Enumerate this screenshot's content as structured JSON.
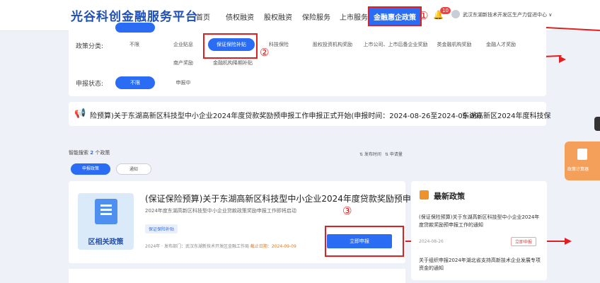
{
  "header": {
    "logo": "光谷科创金融服务平台",
    "nav": [
      "首页",
      "债权融资",
      "股权融资",
      "保险服务",
      "上市服务",
      "金融惠企政策"
    ],
    "notification_count": "10",
    "user": "武汉东湖新技术开发区生产力促进中心 ∨"
  },
  "annotations": {
    "one": "①",
    "two": "②",
    "three": "③"
  },
  "filters": {
    "policy_label": "政策分类:",
    "policy_options": [
      "不限",
      "企业贴息",
      "保证保险补贴",
      "科技保险",
      "股权投资机构奖励",
      "上市公司、上市后备企业奖励",
      "类金融机构奖励",
      "金融人才奖励",
      "南产奖励",
      "金融机构降期补贴"
    ],
    "status_label": "申报状态:",
    "status_options": [
      "不限",
      "申报中"
    ]
  },
  "notice": {
    "text": "险预算)关于东湖高新区科技型中小企业2024年度贷款奖励预申报工作申报正式开始(申报时间：2024-08-26至2024-09-09)",
    "text2": "东湖高新区2024年度科技保"
  },
  "results": {
    "prefix": "智能搜索",
    "count": "2",
    "suffix": "个政策",
    "sort_time": "⇅ 发布时间",
    "sort_views": "⇅ 申请量",
    "tabs": [
      "申报政策",
      "通知"
    ]
  },
  "card": {
    "thumb_label": "区相关政策",
    "title": "(保证保险预算)关于东湖高新区科技型中小企业2024年度贷款奖励预申...",
    "subtitle": "2024年度东湖高新区科技型中小企业贷款政策奖励申报工作即将启动",
    "tag": "保证保险补贴",
    "meta": "2024年 · 发布部门：武汉东湖新技术开发区金融工作局",
    "deadline": "截止日期：2024-09-09",
    "apply": "立即申报"
  },
  "latest": {
    "title": "最新政策",
    "item1": "(保证保险预算)关于东湖高新区科技型中小企业2024年度贷款奖励预申报工作的通知",
    "date1": "2024-08-26",
    "btn1": "立即申报",
    "item2": "关于组织申报2024年湖北省支持高新技术企业发展专项资金的通知"
  },
  "side": {
    "label": "政策计算器"
  }
}
